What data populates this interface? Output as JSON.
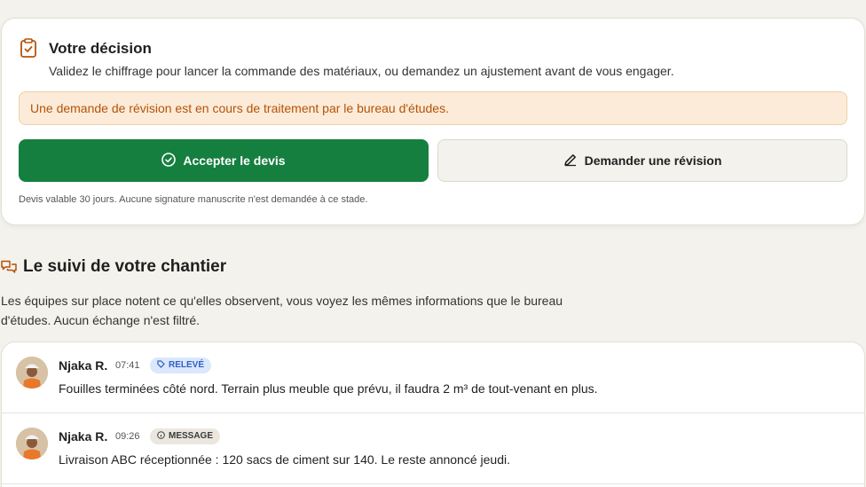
{
  "decision": {
    "title": "Votre décision",
    "description": "Validez le chiffrage pour lancer la commande des matériaux, ou demandez un ajustement avant de vous engager.",
    "alert": "Une demande de révision est en cours de traitement par le bureau d'études.",
    "accept_label": "Accepter le devis",
    "revise_label": "Demander une révision",
    "footnote": "Devis valable 30 jours. Aucune signature manuscrite n'est demandée à ce stade.",
    "icon": "clipboard-check-icon"
  },
  "tracking": {
    "title": "Le suivi de votre chantier",
    "description": "Les équipes sur place notent ce qu'elles observent, vous voyez les mêmes informations que le bureau d'études. Aucun échange n'est filtré.",
    "icon": "chat-bubbles-icon"
  },
  "feed": [
    {
      "author": "Njaka R.",
      "time": "07:41",
      "badge": "RELEVÉ",
      "badge_icon": "tag-icon",
      "text": "Fouilles terminées côté nord. Terrain plus meuble que prévu, il faudra 2 m³ de tout-venant en plus."
    },
    {
      "author": "Njaka R.",
      "time": "09:26",
      "badge": "MESSAGE",
      "badge_icon": "info-icon",
      "text": "Livraison ABC réceptionnée : 120 sacs de ciment sur 140. Le reste annoncé jeudi."
    }
  ],
  "colors": {
    "accent_green": "#157f3f",
    "alert_orange": "#b45309",
    "badge_blue": "#2f5fc4"
  }
}
